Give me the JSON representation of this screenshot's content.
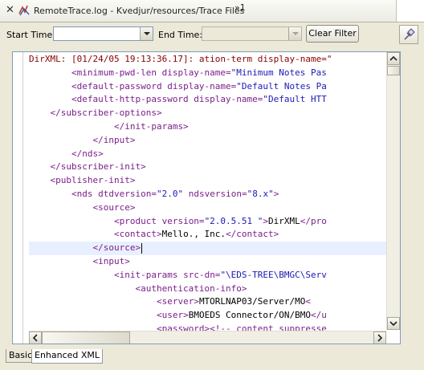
{
  "window": {
    "title": "RemoteTrace.log - Kvedjur/resources/Trace Files",
    "overflow_indicator": "»1"
  },
  "toolbar": {
    "start_time_label": "Start Time:",
    "start_time_value": "",
    "end_time_label": "End Time:",
    "end_time_value": "",
    "clear_filter_label": "Clear Filter"
  },
  "editor": {
    "lines": [
      [
        {
          "c": "mar",
          "t": "DirXML: [01/24/05 19:13:36.17]: ation-term display-name=\""
        }
      ],
      [
        {
          "c": "sp",
          "t": "        "
        },
        {
          "c": "tag",
          "t": "<minimum-pwd-len"
        },
        {
          "c": "att",
          "t": " display-name="
        },
        {
          "c": "val",
          "t": "\"Minimum Notes Pas"
        }
      ],
      [
        {
          "c": "sp",
          "t": "        "
        },
        {
          "c": "tag",
          "t": "<default-password"
        },
        {
          "c": "att",
          "t": " display-name="
        },
        {
          "c": "val",
          "t": "\"Default Notes Pa"
        }
      ],
      [
        {
          "c": "sp",
          "t": "        "
        },
        {
          "c": "tag",
          "t": "<default-http-password"
        },
        {
          "c": "att",
          "t": " display-name="
        },
        {
          "c": "val",
          "t": "\"Default HTT"
        }
      ],
      [
        {
          "c": "sp",
          "t": "    "
        },
        {
          "c": "tag",
          "t": "</subscriber-options>"
        }
      ],
      [
        {
          "c": "sp",
          "t": "                "
        },
        {
          "c": "tag",
          "t": "</init-params>"
        }
      ],
      [
        {
          "c": "sp",
          "t": "            "
        },
        {
          "c": "tag",
          "t": "</input>"
        }
      ],
      [
        {
          "c": "sp",
          "t": "        "
        },
        {
          "c": "tag",
          "t": "</nds>"
        }
      ],
      [
        {
          "c": "sp",
          "t": "    "
        },
        {
          "c": "tag",
          "t": "</subscriber-init>"
        }
      ],
      [
        {
          "c": "sp",
          "t": "    "
        },
        {
          "c": "tag",
          "t": "<publisher-init>"
        }
      ],
      [
        {
          "c": "sp",
          "t": "        "
        },
        {
          "c": "tag",
          "t": "<nds"
        },
        {
          "c": "att",
          "t": " dtdversion="
        },
        {
          "c": "val",
          "t": "\"2.0\""
        },
        {
          "c": "att",
          "t": " ndsversion="
        },
        {
          "c": "val",
          "t": "\"8.x\""
        },
        {
          "c": "tag",
          "t": ">"
        }
      ],
      [
        {
          "c": "sp",
          "t": "            "
        },
        {
          "c": "tag",
          "t": "<source>"
        }
      ],
      [
        {
          "c": "sp",
          "t": "                "
        },
        {
          "c": "tag",
          "t": "<product"
        },
        {
          "c": "att",
          "t": " version="
        },
        {
          "c": "val",
          "t": "\"2.0.5.51 \""
        },
        {
          "c": "tag",
          "t": ">"
        },
        {
          "c": "txt",
          "t": "DirXML"
        },
        {
          "c": "tag",
          "t": "</pro"
        }
      ],
      [
        {
          "c": "sp",
          "t": "                "
        },
        {
          "c": "tag",
          "t": "<contact>"
        },
        {
          "c": "txt",
          "t": "Mello., Inc."
        },
        {
          "c": "tag",
          "t": "</contact>"
        }
      ],
      [
        {
          "c": "sp",
          "t": "            "
        },
        {
          "c": "tag",
          "t": "</source>"
        }
      ],
      [
        {
          "c": "sp",
          "t": "            "
        },
        {
          "c": "tag",
          "t": "<input>"
        }
      ],
      [
        {
          "c": "sp",
          "t": "                "
        },
        {
          "c": "tag",
          "t": "<init-params"
        },
        {
          "c": "att",
          "t": " src-dn="
        },
        {
          "c": "val",
          "t": "\"\\EDS-TREE\\BMGC\\Serv"
        }
      ],
      [
        {
          "c": "sp",
          "t": "                    "
        },
        {
          "c": "tag",
          "t": "<authentication-info>"
        }
      ],
      [
        {
          "c": "sp",
          "t": "                        "
        },
        {
          "c": "tag",
          "t": "<server>"
        },
        {
          "c": "txt",
          "t": "MTORLNAP03/Server/MO"
        },
        {
          "c": "tag",
          "t": "<"
        }
      ],
      [
        {
          "c": "sp",
          "t": "                        "
        },
        {
          "c": "tag",
          "t": "<user>"
        },
        {
          "c": "txt",
          "t": "BMOEDS Connector/ON/BMO"
        },
        {
          "c": "tag",
          "t": "</u"
        }
      ],
      [
        {
          "c": "sp",
          "t": "                        "
        },
        {
          "c": "tag",
          "t": "<password>"
        },
        {
          "c": "tag",
          "t": "<!-- content suppresse"
        }
      ]
    ],
    "highlight_line": 14
  },
  "tabs": [
    {
      "label": "Basic"
    },
    {
      "label": "Enhanced XML"
    }
  ],
  "colors": {
    "tag": "#7a1f8a",
    "value": "#1a1ab5",
    "prefix": "#8a0000",
    "highlight": "#e8f0ff"
  }
}
